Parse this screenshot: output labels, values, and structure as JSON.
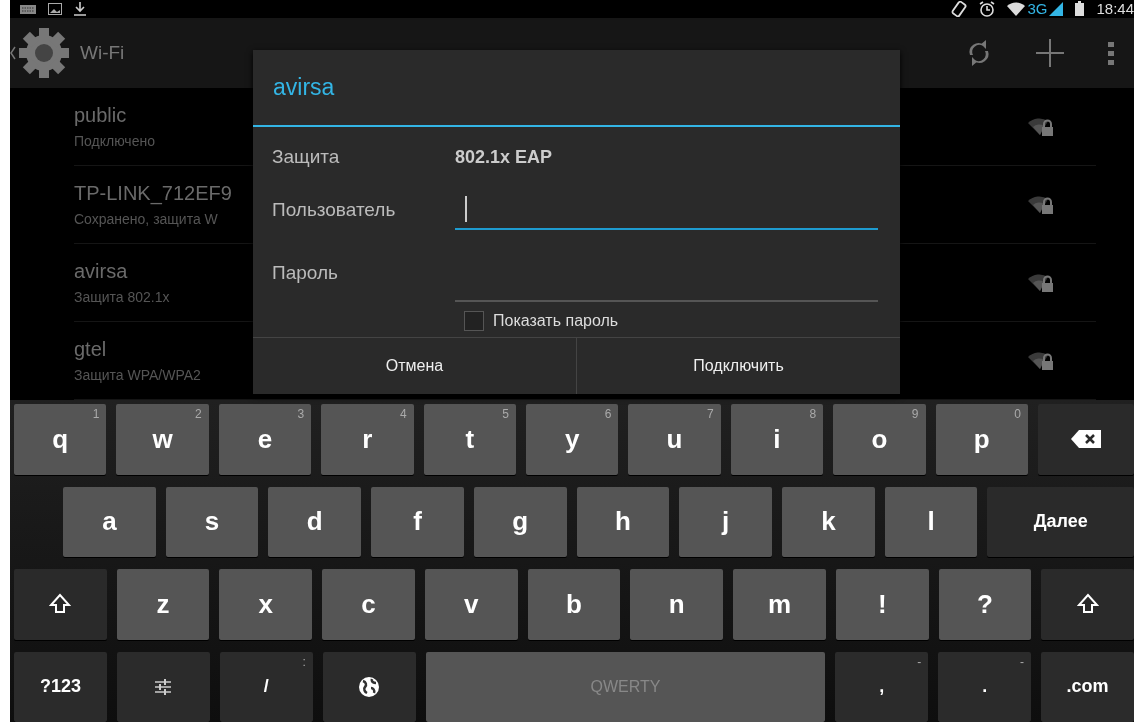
{
  "status_bar": {
    "network": "3G",
    "time": "18:44"
  },
  "action_bar": {
    "title": "Wi-Fi"
  },
  "networks": [
    {
      "name": "public",
      "status": "Подключено"
    },
    {
      "name": "TP-LINK_712EF9",
      "status": "Сохранено, защита W"
    },
    {
      "name": "avirsa",
      "status": "Защита 802.1x"
    },
    {
      "name": "gtel",
      "status": "Защита WPA/WPA2"
    }
  ],
  "dialog": {
    "title": "avirsa",
    "security_label": "Защита",
    "security_value": "802.1x EAP",
    "fields": [
      {
        "label": "Пользователь",
        "focused": true
      },
      {
        "label": "Пароль",
        "focused": false
      }
    ],
    "show_password": {
      "label": "Показать пароль",
      "checked": false
    },
    "buttons": [
      "Отмена",
      "Подключить"
    ]
  },
  "keyboard": {
    "rows": [
      {
        "keys": [
          {
            "kind": "letter",
            "label": "q",
            "hint": "1"
          },
          {
            "kind": "letter",
            "label": "w",
            "hint": "2"
          },
          {
            "kind": "letter",
            "label": "e",
            "hint": "3"
          },
          {
            "kind": "letter",
            "label": "r",
            "hint": "4"
          },
          {
            "kind": "letter",
            "label": "t",
            "hint": "5"
          },
          {
            "kind": "letter",
            "label": "y",
            "hint": "6"
          },
          {
            "kind": "letter",
            "label": "u",
            "hint": "7"
          },
          {
            "kind": "letter",
            "label": "i",
            "hint": "8"
          },
          {
            "kind": "letter",
            "label": "o",
            "hint": "9"
          },
          {
            "kind": "letter",
            "label": "p",
            "hint": "0"
          },
          {
            "kind": "backspace"
          }
        ]
      },
      {
        "keys": [
          {
            "kind": "letter",
            "label": "a"
          },
          {
            "kind": "letter",
            "label": "s"
          },
          {
            "kind": "letter",
            "label": "d"
          },
          {
            "kind": "letter",
            "label": "f"
          },
          {
            "kind": "letter",
            "label": "g"
          },
          {
            "kind": "letter",
            "label": "h"
          },
          {
            "kind": "letter",
            "label": "j"
          },
          {
            "kind": "letter",
            "label": "k"
          },
          {
            "kind": "letter",
            "label": "l"
          },
          {
            "kind": "enter",
            "label": "Далее"
          }
        ]
      },
      {
        "keys": [
          {
            "kind": "shift"
          },
          {
            "kind": "letter",
            "label": "z"
          },
          {
            "kind": "letter",
            "label": "x"
          },
          {
            "kind": "letter",
            "label": "c"
          },
          {
            "kind": "letter",
            "label": "v"
          },
          {
            "kind": "letter",
            "label": "b"
          },
          {
            "kind": "letter",
            "label": "n"
          },
          {
            "kind": "letter",
            "label": "m"
          },
          {
            "kind": "letter",
            "label": "!"
          },
          {
            "kind": "letter",
            "label": "?"
          },
          {
            "kind": "shift"
          }
        ]
      },
      {
        "keys": [
          {
            "kind": "function",
            "label": "?123"
          },
          {
            "kind": "settings"
          },
          {
            "kind": "function",
            "label": "/",
            "hint": ":"
          },
          {
            "kind": "globe"
          },
          {
            "kind": "space",
            "label": "QWERTY"
          },
          {
            "kind": "function",
            "label": ",",
            "hint": "-"
          },
          {
            "kind": "function",
            "label": ".",
            "hint": "-"
          },
          {
            "kind": "function",
            "label": ".com"
          }
        ]
      }
    ]
  }
}
